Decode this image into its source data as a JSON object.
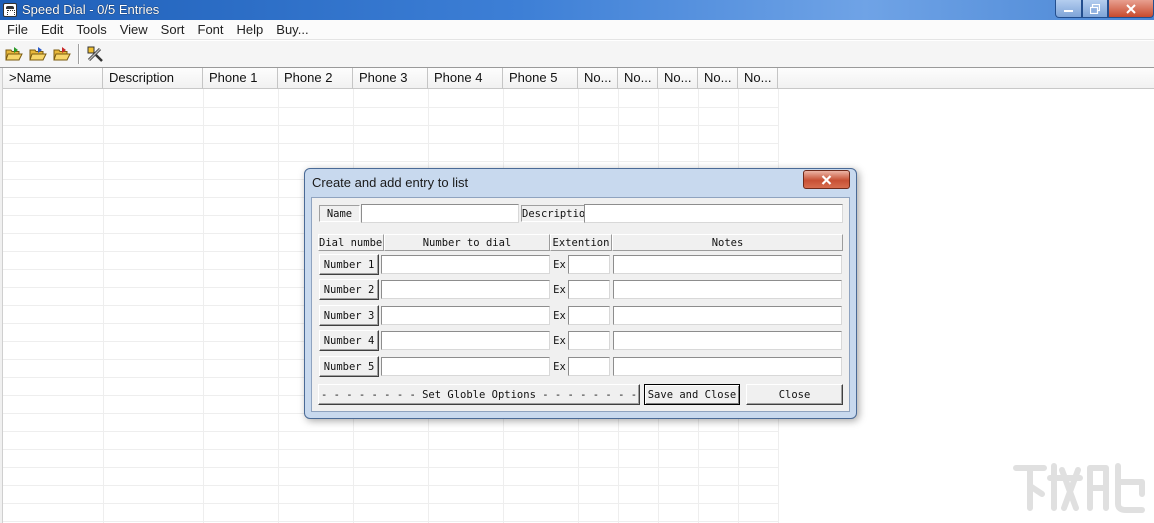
{
  "window": {
    "title": "Speed Dial - 0/5 Entries"
  },
  "menu": [
    "File",
    "Edit",
    "Tools",
    "View",
    "Sort",
    "Font",
    "Help",
    "Buy..."
  ],
  "toolbar": {
    "icons": [
      "open-folder-green-icon",
      "open-folder-blue-icon",
      "open-folder-red-icon",
      "tools-wrench-icon"
    ]
  },
  "list": {
    "columns": [
      ">Name",
      "Description",
      "Phone 1",
      "Phone 2",
      "Phone 3",
      "Phone 4",
      "Phone 5",
      "No...",
      "No...",
      "No...",
      "No...",
      "No..."
    ],
    "rows": []
  },
  "dialog": {
    "title": "Create and add entry to list",
    "name_label": "Name",
    "name_value": "",
    "description_label": "Description",
    "description_value": "",
    "headers": {
      "dial_number": "Dial number",
      "number_to_dial": "Number to dial",
      "extention": "Extention",
      "notes": "Notes"
    },
    "rows": [
      {
        "button": "Number 1",
        "ex_label": "Ex",
        "number": "",
        "extension": "",
        "notes": ""
      },
      {
        "button": "Number 2",
        "ex_label": "Ex",
        "number": "",
        "extension": "",
        "notes": ""
      },
      {
        "button": "Number 3",
        "ex_label": "Ex",
        "number": "",
        "extension": "",
        "notes": ""
      },
      {
        "button": "Number 4",
        "ex_label": "Ex",
        "number": "",
        "extension": "",
        "notes": ""
      },
      {
        "button": "Number 5",
        "ex_label": "Ex",
        "number": "",
        "extension": "",
        "notes": ""
      }
    ],
    "buttons": {
      "set_options": "- - - - - - - - - Set Globle Options - - - - - - - - -",
      "save_close": "Save and Close",
      "close": "Close"
    }
  },
  "colors": {
    "titlebar": "#3d7fd6",
    "dialog_frame": "#c8d9ee",
    "close_red": "#c75034"
  }
}
